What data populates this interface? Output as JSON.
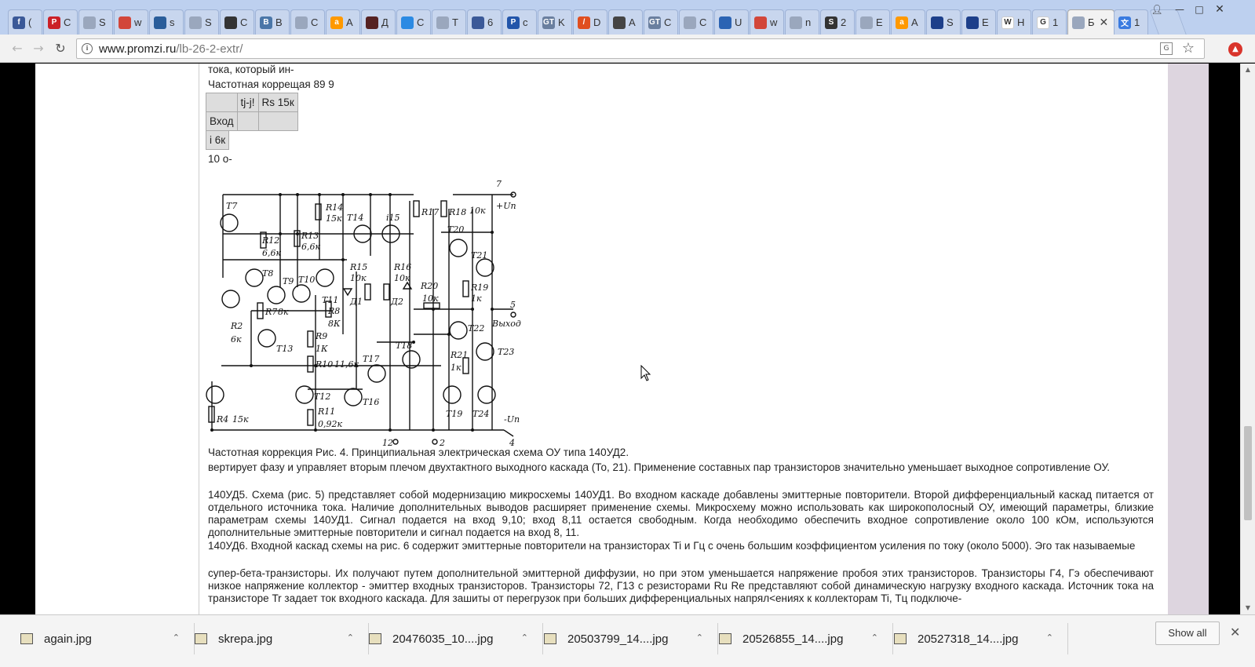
{
  "tabs": [
    {
      "letter": "(",
      "icon": "facebook-icon",
      "color": "#3b5998",
      "glyph": "f"
    },
    {
      "letter": "C",
      "icon": "pinterest-icon",
      "color": "#cb2027",
      "glyph": "P"
    },
    {
      "letter": "S",
      "icon": "page-icon",
      "color": "#9aa7bd",
      "glyph": ""
    },
    {
      "letter": "w",
      "icon": "crab-icon",
      "color": "#d2463a",
      "glyph": ""
    },
    {
      "letter": "s",
      "icon": "flag-icon",
      "color": "#2a5d9a",
      "glyph": ""
    },
    {
      "letter": "S",
      "icon": "page-icon",
      "color": "#9aa7bd",
      "glyph": ""
    },
    {
      "letter": "C",
      "icon": "spy-icon",
      "color": "#333333",
      "glyph": ""
    },
    {
      "letter": "B",
      "icon": "vk-icon",
      "color": "#4a76a8",
      "glyph": "B"
    },
    {
      "letter": "C",
      "icon": "page-icon",
      "color": "#9aa7bd",
      "glyph": ""
    },
    {
      "letter": "A",
      "icon": "amazon-icon",
      "color": "#ff9900",
      "glyph": "a"
    },
    {
      "letter": "Д",
      "icon": "person-icon",
      "color": "#552222",
      "glyph": ""
    },
    {
      "letter": "C",
      "icon": "circle-icon",
      "color": "#2b8ae3",
      "glyph": ""
    },
    {
      "letter": "T",
      "icon": "page-icon",
      "color": "#9aa7bd",
      "glyph": ""
    },
    {
      "letter": "6",
      "icon": "globe-icon",
      "color": "#3b5998",
      "glyph": ""
    },
    {
      "letter": "c",
      "icon": "p-icon",
      "color": "#2255aa",
      "glyph": "P"
    },
    {
      "letter": "K",
      "icon": "gt-icon",
      "color": "#6a7f9f",
      "glyph": "GT"
    },
    {
      "letter": "D",
      "icon": "slash-icon",
      "color": "#e04e1f",
      "glyph": "/"
    },
    {
      "letter": "A",
      "icon": "box-icon",
      "color": "#444444",
      "glyph": ""
    },
    {
      "letter": "C",
      "icon": "gt-icon",
      "color": "#6a7f9f",
      "glyph": "GT"
    },
    {
      "letter": "C",
      "icon": "page-icon",
      "color": "#9aa7bd",
      "glyph": ""
    },
    {
      "letter": "U",
      "icon": "mail-icon",
      "color": "#2b63b3",
      "glyph": ""
    },
    {
      "letter": "w",
      "icon": "crab-icon",
      "color": "#d2463a",
      "glyph": ""
    },
    {
      "letter": "n",
      "icon": "page-icon",
      "color": "#9aa7bd",
      "glyph": ""
    },
    {
      "letter": "2",
      "icon": "s-icon",
      "color": "#333333",
      "glyph": "S"
    },
    {
      "letter": "E",
      "icon": "page-icon",
      "color": "#9aa7bd",
      "glyph": ""
    },
    {
      "letter": "A",
      "icon": "amazon-icon",
      "color": "#ff9900",
      "glyph": "a"
    },
    {
      "letter": "S",
      "icon": "planet-icon",
      "color": "#1d3f8a",
      "glyph": ""
    },
    {
      "letter": "E",
      "icon": "planet-icon",
      "color": "#1d3f8a",
      "glyph": ""
    },
    {
      "letter": "H",
      "icon": "wikipedia-icon",
      "color": "#ffffff",
      "glyph": "W"
    },
    {
      "letter": "1",
      "icon": "google-icon",
      "color": "#ffffff",
      "glyph": "G"
    },
    {
      "letter": "Б",
      "icon": "page-icon",
      "color": "#9aa7bd",
      "glyph": "",
      "active": true
    },
    {
      "letter": "1",
      "icon": "translate-icon",
      "color": "#3a7be0",
      "glyph": "文"
    }
  ],
  "url": {
    "host": "www.promzi.ru",
    "path": "/lb-26-2-extr/"
  },
  "page": {
    "line_cut": "тока, который ин-",
    "heading_small": "Частотная коррещая 89 9",
    "table": {
      "header": [
        "",
        "tj-j!",
        "Rs 15к"
      ],
      "row1": [
        "Вход",
        "",
        ""
      ],
      "row2": [
        "i 6к"
      ]
    },
    "line_10": "10 о-",
    "caption": "Частотная коррекция Рис. 4. Принципиальная электрическая схема ОУ типа 140УД2.",
    "para1": "вертирует фазу и управляет вторым плечом двухтактного выходного каскада (То, 21). Применение составных пар транзисторов значительно уменьшает выходное сопротивление ОУ.",
    "para2": "140УД5. Схема (рис. 5) представляет собой модернизацию микросхемы 140УД1. Во входном каскаде добавлены эмиттерные повторители. Второй дифференциальный каскад питается от отдельного источника тока. Наличие дополнительных выводов расширяет применение схемы. Микросхему можно использовать как широкополосный ОУ, имеющий параметры, близкие параметрам схемы 140УД1. Сигнал подается на вход 9,10; вход 8,11 остается свободным. Когда необходимо обеспечить входное сопротивление около 100 кОм, используются дополнительные эмиттерные повторители и сигнал подается на вход 8, 11.",
    "para3": "140УД6. Входной каскад схемы на рис. 6 содержит эмиттерные повторители на транзисторах Ti и Гц с очень большим коэффициентом усиления по току (около 5000). Эго так называемые",
    "para4": "супер-бета-транзисторы. Их получают путем дополнительной эмиттерной диффузии, но при этом уменьшается напряжение пробоя этих транзисторов. Транзисторы Г4, Гэ обеспечивают низкое напряжение коллектор - эмиттер входных транзисторов. Транзисторы 72, Г13 с резисторами Ru Re представляют собой динамическую нагрузку входного каскада. Источник тока на транзисторе Tr задает ток входного каскада. Для зашиты от перегрузок при больших дифференциальных напрял<ениях к коллекторам Ti, Тц подключе-"
  },
  "schematic_labels": {
    "pin7": "7",
    "pin5": "5",
    "pin12": "12",
    "pin2": "2",
    "pin4": "4",
    "vplus": "+Uп",
    "vminus": "-Uп",
    "out": "Выход",
    "T7": "T7",
    "T8": "T8",
    "T9": "T9",
    "T10": "T10",
    "T11": "T11",
    "T12": "T12",
    "T13": "T13",
    "T14": "T14",
    "T15": "i15",
    "T16": "T16",
    "T17": "T17",
    "T18": "T18",
    "T19": "T19",
    "T20": "T20",
    "T21": "T21",
    "T22": "T22",
    "T23": "T23",
    "T24": "T24",
    "R2": "R2",
    "R2v": "6к",
    "R4": "R4",
    "R4v": "15к",
    "R7": "R7",
    "R7v": "8к",
    "R8": "R8",
    "R8v": "8К",
    "R9": "R9",
    "R9v": "1К",
    "R10": "R10",
    "R10v": "11,6к",
    "R11": "R11",
    "R11v": "0,92к",
    "R12": "R12",
    "R12v": "6,6к",
    "R13": "R13",
    "R13v": "6,6к",
    "R14": "R14",
    "R14v": "15к",
    "R15": "R15",
    "R15v": "10к",
    "R16": "R16",
    "R16v": "10к",
    "R17": "R17",
    "R18": "R18",
    "R18v": "10к",
    "R19": "R19",
    "R19v": "1к",
    "R20": "R20",
    "R20v": "10к",
    "R21": "R21",
    "R21v": "1к",
    "D1": "Д1",
    "D2": "Д2"
  },
  "downloads": [
    {
      "name": "again.jpg"
    },
    {
      "name": "skrepa.jpg"
    },
    {
      "name": "20476035_10....jpg"
    },
    {
      "name": "20503799_14....jpg"
    },
    {
      "name": "20526855_14....jpg"
    },
    {
      "name": "20527318_14....jpg"
    }
  ],
  "show_all": "Show all"
}
